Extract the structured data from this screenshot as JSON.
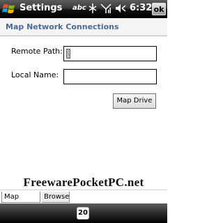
{
  "titlebar": {
    "title": "Settings",
    "input_mode": "abc",
    "time": "6:32",
    "ok_label": "ok",
    "icons": [
      "windows-start-icon",
      "connectivity-icon",
      "signal-icon",
      "volume-icon"
    ]
  },
  "header": {
    "title": "Map Network Connections"
  },
  "form": {
    "remote_path_label": "Remote Path:",
    "remote_path_value": "",
    "local_name_label": "Local Name:",
    "local_name_value": "",
    "map_drive_label": "Map Drive"
  },
  "watermark": "FreewarePocketPC.net",
  "tabs": [
    {
      "label": "Map Drive",
      "active": true
    },
    {
      "label": "Browse",
      "active": false
    }
  ],
  "bottombar": {
    "sip_label": "20"
  },
  "colors": {
    "accent": "#4a6a93",
    "bar": "#000000"
  }
}
